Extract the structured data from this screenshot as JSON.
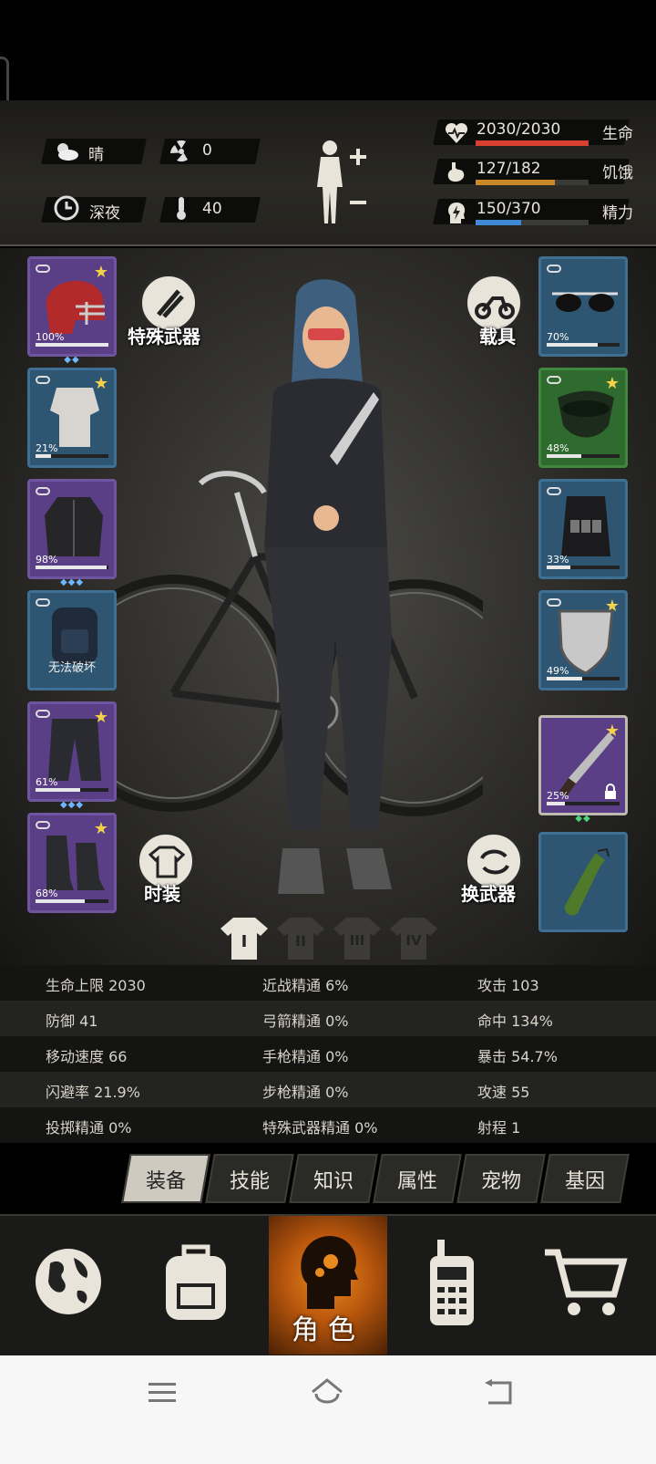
{
  "hud": {
    "weather": "晴",
    "radiation": "0",
    "time_of_day": "深夜",
    "temperature": "40",
    "health": {
      "text": "2030/2030",
      "label": "生命",
      "fraction": 1.0,
      "color": "#d8412f"
    },
    "hunger": {
      "text": "127/182",
      "label": "饥饿",
      "fraction": 0.698,
      "color": "#c9892a"
    },
    "energy": {
      "text": "150/370",
      "label": "精力",
      "fraction": 0.405,
      "color": "#3f88d6"
    }
  },
  "buttons": {
    "special_weapon": "特殊武器",
    "vehicle": "载具",
    "fashion": "时装",
    "swap_weapon": "换武器"
  },
  "left_slots": [
    {
      "name": "helmet",
      "pct": "100%",
      "durability": 1.0,
      "rarity": "purple",
      "star": true,
      "gems": "◆◆"
    },
    {
      "name": "shirt",
      "pct": "21%",
      "durability": 0.21,
      "rarity": "blue",
      "star": true,
      "gems": ""
    },
    {
      "name": "jacket",
      "pct": "98%",
      "durability": 0.98,
      "rarity": "purple",
      "star": false,
      "gems": "◆◆◆"
    },
    {
      "name": "backpack",
      "msg": "无法破坏",
      "rarity": "blue",
      "star": false,
      "gems": ""
    },
    {
      "name": "pants",
      "pct": "61%",
      "durability": 0.61,
      "rarity": "purple",
      "star": true,
      "gems": "◆◆◆"
    },
    {
      "name": "boots",
      "pct": "68%",
      "durability": 0.68,
      "rarity": "purple",
      "star": true,
      "gems": ""
    }
  ],
  "right_slots": [
    {
      "name": "glasses",
      "pct": "70%",
      "durability": 0.7,
      "rarity": "blue",
      "star": false
    },
    {
      "name": "mask",
      "pct": "48%",
      "durability": 0.48,
      "rarity": "green",
      "star": true
    },
    {
      "name": "vest",
      "pct": "33%",
      "durability": 0.33,
      "rarity": "blue",
      "star": false
    },
    {
      "name": "shield",
      "pct": "49%",
      "durability": 0.49,
      "rarity": "blue",
      "star": true
    },
    {
      "name": "machete",
      "pct": "25%",
      "durability": 0.25,
      "rarity": "purple",
      "star": true,
      "locked": true,
      "gems": "◆◆"
    },
    {
      "name": "molotov",
      "rarity": "blue",
      "star": false
    }
  ],
  "outfit_tabs": [
    "I",
    "II",
    "III",
    "IV"
  ],
  "stats": [
    [
      "生命上限 2030",
      "近战精通 6%",
      "攻击 103"
    ],
    [
      "防御 41",
      "弓箭精通 0%",
      "命中 134%"
    ],
    [
      "移动速度 66",
      "手枪精通 0%",
      "暴击 54.7%"
    ],
    [
      "闪避率 21.9%",
      "步枪精通 0%",
      "攻速 55"
    ],
    [
      "投掷精通 0%",
      "特殊武器精通 0%",
      "射程 1"
    ]
  ],
  "sub_tabs": [
    "装备",
    "技能",
    "知识",
    "属性",
    "宠物",
    "基因"
  ],
  "nav": {
    "character": "角色"
  },
  "colors": {
    "accent_orange": "#e98a1e",
    "purple_slot": "#5b3f86",
    "blue_slot": "#2e5572",
    "green_slot": "#2f6a2e"
  }
}
